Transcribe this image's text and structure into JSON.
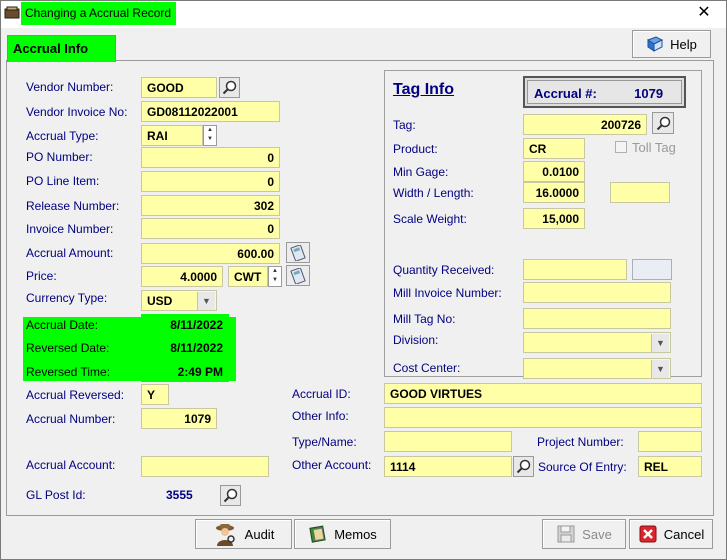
{
  "window": {
    "title": "Changing a Accrual Record",
    "close_glyph": "✕"
  },
  "tab": {
    "label": "Accrual Info"
  },
  "help_button": {
    "label": "Help",
    "icon": "book-icon"
  },
  "left": {
    "vendor_number": {
      "label": "Vendor Number:",
      "value": "GOOD"
    },
    "vendor_invoice": {
      "label": "Vendor Invoice No:",
      "value": "GD08112022001"
    },
    "accrual_type": {
      "label": "Accrual Type:",
      "value": "RAI"
    },
    "po_number": {
      "label": "PO Number:",
      "value": "0"
    },
    "po_line_item": {
      "label": "PO Line Item:",
      "value": "0"
    },
    "release_number": {
      "label": "Release Number:",
      "value": "302"
    },
    "invoice_number": {
      "label": "Invoice Number:",
      "value": "0"
    },
    "accrual_amount": {
      "label": "Accrual Amount:",
      "value": "600.00"
    },
    "price": {
      "label": "Price:",
      "value": "4.0000",
      "unit": "CWT"
    },
    "currency_type": {
      "label": "Currency Type:",
      "value": "USD"
    },
    "accrual_date": {
      "label": "Accrual Date:",
      "value": "8/11/2022"
    },
    "reversed_date": {
      "label": "Reversed Date:",
      "value": "8/11/2022"
    },
    "reversed_time": {
      "label": "Reversed Time:",
      "value": "2:49 PM"
    },
    "accrual_reversed": {
      "label": "Accrual Reversed:",
      "value": "Y"
    },
    "accrual_number": {
      "label": "Accrual Number:",
      "value": "1079"
    },
    "accrual_account": {
      "label": "Accrual Account:",
      "value": ""
    },
    "gl_post_id": {
      "label": "GL Post Id:",
      "value": "3555"
    }
  },
  "tag_info": {
    "title": "Tag Info",
    "accrual_no_label": "Accrual #:",
    "accrual_no_value": "1079",
    "tag": {
      "label": "Tag:",
      "value": "200726"
    },
    "product": {
      "label": "Product:",
      "value": "CR"
    },
    "toll_tag": {
      "label": "Toll Tag"
    },
    "min_gage": {
      "label": "Min Gage:",
      "value": "0.0100"
    },
    "width_length": {
      "label": "Width / Length:",
      "value": "16.0000",
      "value2": ""
    },
    "scale_weight": {
      "label": "Scale Weight:",
      "value": "15,000"
    },
    "quantity_received": {
      "label": "Quantity Received:",
      "value": ""
    },
    "mill_invoice_number": {
      "label": "Mill Invoice Number:",
      "value": ""
    },
    "mill_tag_no": {
      "label": "Mill Tag No:",
      "value": ""
    },
    "division": {
      "label": "Division:",
      "value": ""
    },
    "cost_center": {
      "label": "Cost Center:",
      "value": ""
    }
  },
  "right_lower": {
    "accrual_id": {
      "label": "Accrual ID:",
      "value": "GOOD VIRTUES"
    },
    "other_info": {
      "label": "Other Info:",
      "value": ""
    },
    "type_name": {
      "label": "Type/Name:",
      "value": ""
    },
    "project_number": {
      "label": "Project Number:",
      "value": ""
    },
    "other_account": {
      "label": "Other Account:",
      "value": "1114"
    },
    "source_of_entry": {
      "label": "Source Of Entry:",
      "value": "REL"
    }
  },
  "bottom": {
    "audit": "Audit",
    "memos": "Memos",
    "save": "Save",
    "cancel": "Cancel"
  },
  "colors": {
    "highlight": "#00ff00",
    "field_bg": "#ffffa8",
    "label_text": "#000080"
  }
}
